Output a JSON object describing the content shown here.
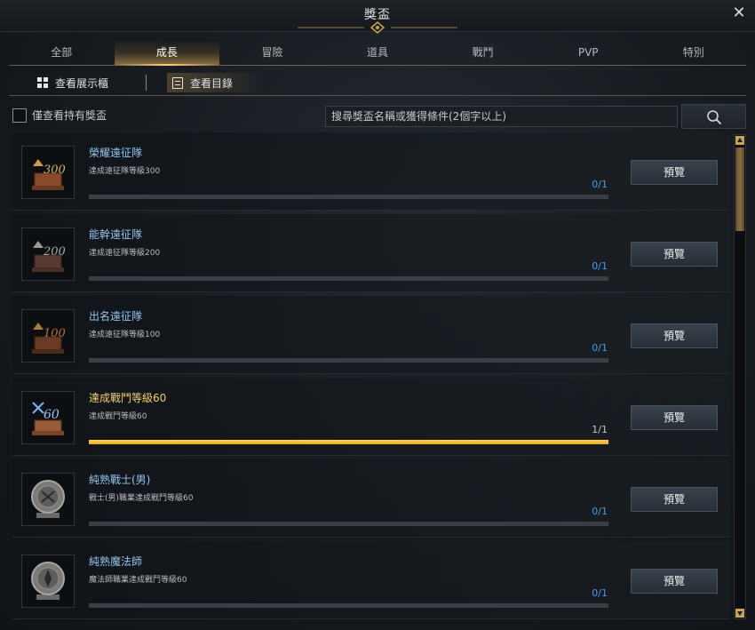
{
  "window": {
    "title": "獎盃"
  },
  "tabs": [
    {
      "label": "全部"
    },
    {
      "label": "成長",
      "active": true
    },
    {
      "label": "冒險"
    },
    {
      "label": "道具"
    },
    {
      "label": "戰鬥"
    },
    {
      "label": "PVP"
    },
    {
      "label": "特別"
    }
  ],
  "view": {
    "showcase_label": "查看展示櫃",
    "catalog_label": "查看目錄"
  },
  "filter": {
    "owned_only_label": "僅查看持有獎盃",
    "owned_only_checked": false,
    "search_placeholder": "搜尋獎盃名稱或獲得條件(2個字以上)"
  },
  "trophies": [
    {
      "name": "榮耀遠征隊",
      "condition": "達成遠征隊等級300",
      "count": "0/1",
      "progress": 0,
      "icon": "expedition-300-trophy-icon",
      "badge": "300",
      "completed": false
    },
    {
      "name": "能幹遠征隊",
      "condition": "達成遠征隊等級200",
      "count": "0/1",
      "progress": 0,
      "icon": "expedition-200-trophy-icon",
      "badge": "200",
      "completed": false
    },
    {
      "name": "出名遠征隊",
      "condition": "達成遠征隊等級100",
      "count": "0/1",
      "progress": 0,
      "icon": "expedition-100-trophy-icon",
      "badge": "100",
      "completed": false
    },
    {
      "name": "達成戰鬥等級60",
      "condition": "達成戰鬥等級60",
      "count": "1/1",
      "progress": 1,
      "icon": "combat-level-60-trophy-icon",
      "badge": "60",
      "completed": true
    },
    {
      "name": "純熟戰士(男)",
      "condition": "戰士(男)職業達成戰鬥等級60",
      "count": "0/1",
      "progress": 0,
      "icon": "warrior-medal-icon",
      "completed": false
    },
    {
      "name": "純熟魔法師",
      "condition": "魔法師職業達成戰鬥等級60",
      "count": "0/1",
      "progress": 0,
      "icon": "mage-medal-icon",
      "completed": false
    }
  ],
  "preview_label": "預覽",
  "colors": {
    "accent_gold": "#f3cf6a",
    "progress_fill": "#f2a414",
    "link_blue": "#8fc7ec",
    "count_blue": "#3f9ee8"
  }
}
